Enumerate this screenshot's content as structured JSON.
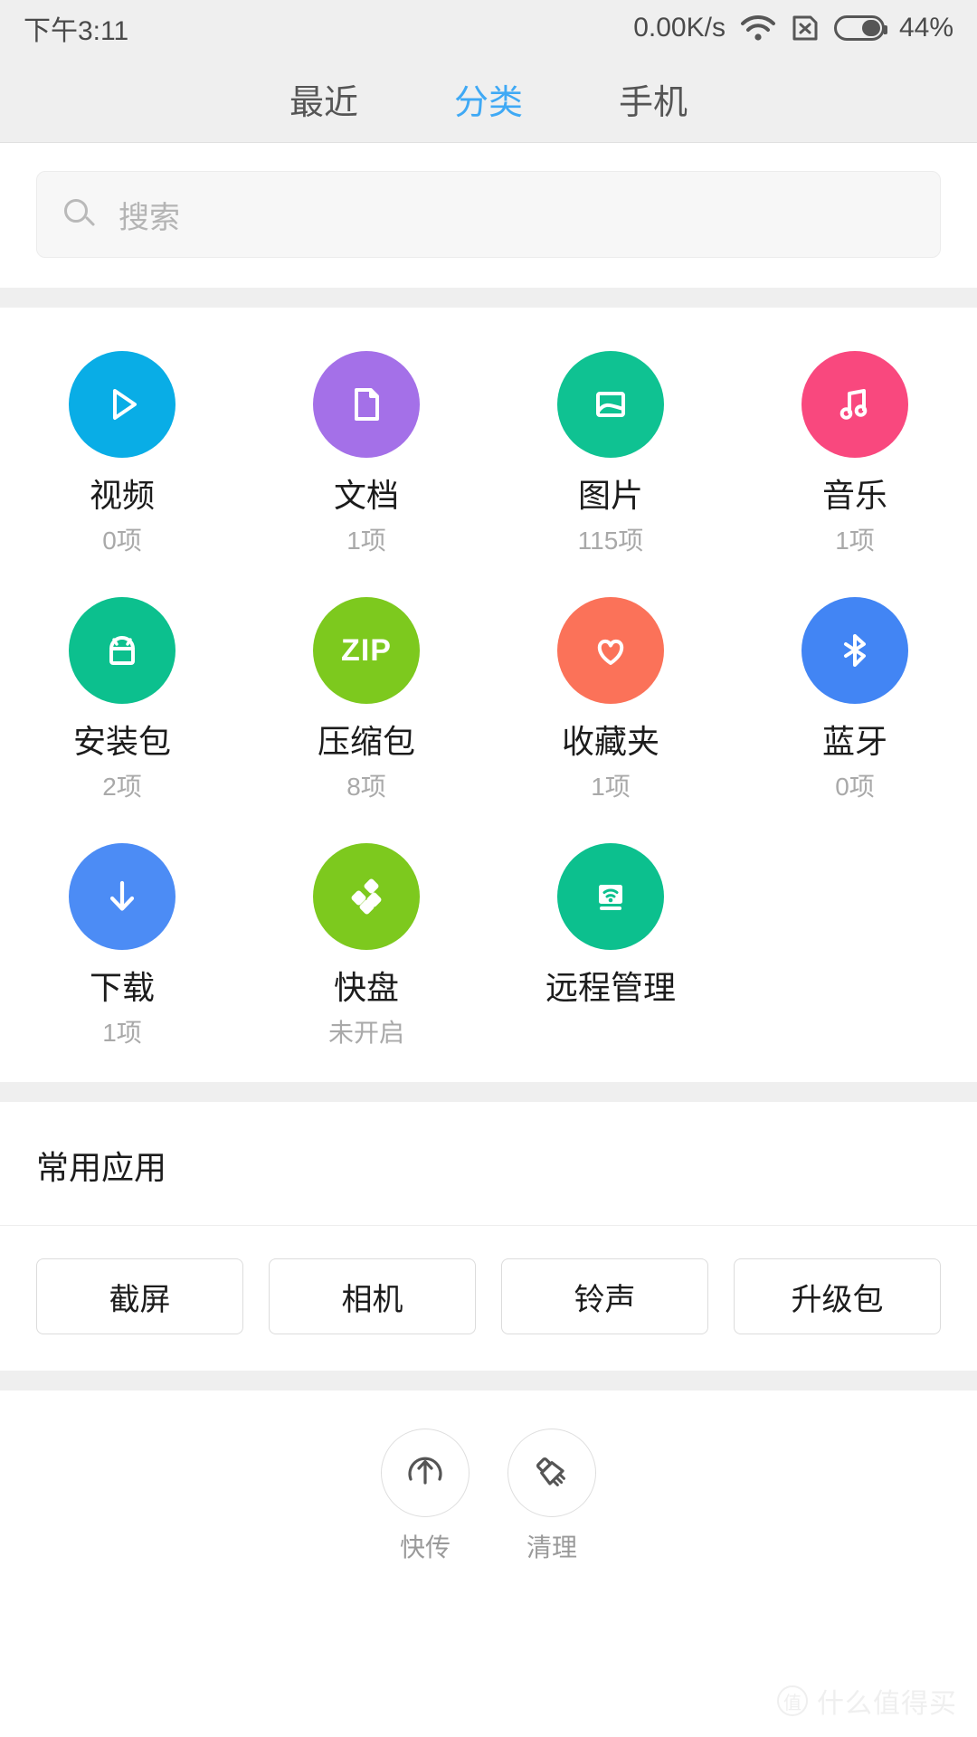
{
  "status_bar": {
    "time": "下午3:11",
    "network_speed": "0.00K/s",
    "wifi_icon": "wifi-icon",
    "sim_icon": "sim-card-disabled-icon",
    "battery_percent": "44%",
    "battery_level": 44
  },
  "tabs": [
    {
      "label": "最近",
      "active": false
    },
    {
      "label": "分类",
      "active": true
    },
    {
      "label": "手机",
      "active": false
    }
  ],
  "search": {
    "placeholder": "搜索",
    "icon": "search-icon"
  },
  "categories": [
    {
      "label": "视频",
      "count": "0项",
      "icon": "play-icon",
      "color": "#09ade6"
    },
    {
      "label": "文档",
      "count": "1项",
      "icon": "document-icon",
      "color": "#a470e8"
    },
    {
      "label": "图片",
      "count": "115项",
      "icon": "image-icon",
      "color": "#0fc292"
    },
    {
      "label": "音乐",
      "count": "1项",
      "icon": "music-note-icon",
      "color": "#f9487e"
    },
    {
      "label": "安装包",
      "count": "2项",
      "icon": "android-icon",
      "color": "#0cc08e"
    },
    {
      "label": "压缩包",
      "count": "8项",
      "icon": "zip-icon",
      "color": "#7dc91e"
    },
    {
      "label": "收藏夹",
      "count": "1项",
      "icon": "heart-icon",
      "color": "#fb7259"
    },
    {
      "label": "蓝牙",
      "count": "0项",
      "icon": "bluetooth-icon",
      "color": "#4285f4"
    },
    {
      "label": "下载",
      "count": "1项",
      "icon": "download-icon",
      "color": "#4c8cf5"
    },
    {
      "label": "快盘",
      "count": "未开启",
      "icon": "kuaipan-icon",
      "color": "#7dc91e"
    },
    {
      "label": "远程管理",
      "count": "",
      "icon": "remote-wifi-icon",
      "color": "#0cc08e"
    }
  ],
  "common_apps": {
    "title": "常用应用",
    "chips": [
      {
        "label": "截屏"
      },
      {
        "label": "相机"
      },
      {
        "label": "铃声"
      },
      {
        "label": "升级包"
      }
    ]
  },
  "bottom_bar": [
    {
      "label": "快传",
      "icon": "fast-transfer-icon"
    },
    {
      "label": "清理",
      "icon": "broom-clean-icon"
    }
  ],
  "watermark": {
    "badge": "值",
    "text": "什么值得买"
  }
}
